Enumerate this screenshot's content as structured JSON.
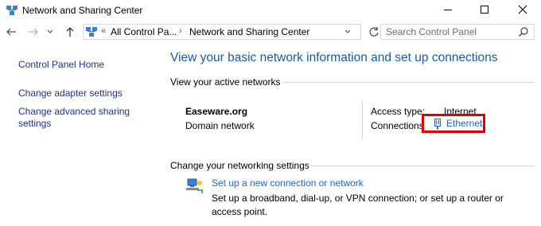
{
  "window": {
    "title": "Network and Sharing Center"
  },
  "address": {
    "overflow": "«",
    "crumbs": [
      "All Control Pa...",
      "Network and Sharing Center"
    ]
  },
  "search": {
    "placeholder": "Search Control Panel"
  },
  "left_pane": {
    "home": "Control Panel Home",
    "adapter": "Change adapter settings",
    "advanced": "Change advanced sharing settings"
  },
  "main": {
    "title": "View your basic network information and set up connections",
    "active_label": "View your active networks",
    "network": {
      "name": "Easeware.org",
      "type": "Domain network",
      "access_key": "Access type:",
      "access_value": "Internet",
      "connections_key": "Connections:",
      "connections_value": "Ethernet"
    },
    "change_label": "Change your networking settings",
    "setup": {
      "link": "Set up a new connection or network",
      "desc": "Set up a broadband, dial-up, or VPN connection; or set up a router or access point."
    }
  },
  "colors": {
    "link": "#1e3287",
    "title": "#1e5aa0",
    "highlight": "#e00000"
  },
  "icons": [
    "network-icon",
    "back-arrow-icon",
    "forward-arrow-icon",
    "chevron-down-icon",
    "up-arrow-icon",
    "refresh-icon",
    "search-icon",
    "ethernet-icon",
    "setup-connection-icon"
  ]
}
